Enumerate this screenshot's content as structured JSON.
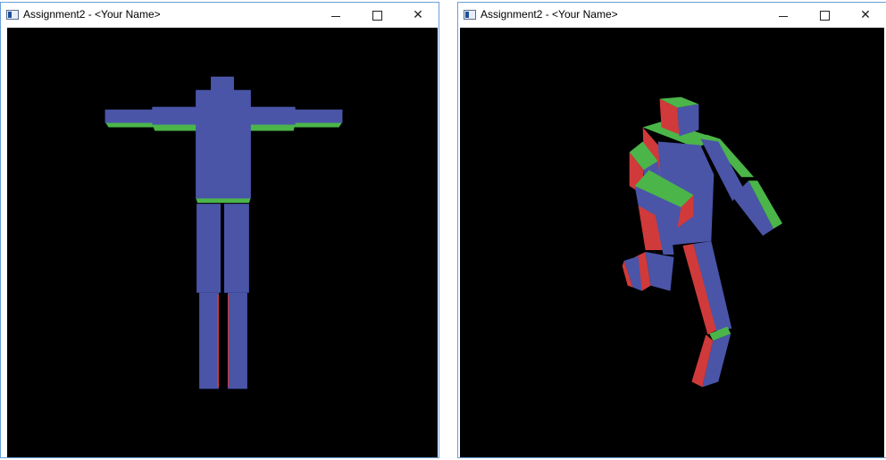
{
  "colors": {
    "front_face": "#4a55a8",
    "side_face": "#d03a3a",
    "top_face": "#4bb54a",
    "background": "#000000"
  },
  "windows": [
    {
      "title": "Assignment2 - <Your Name>",
      "pose": "T-pose, front view"
    },
    {
      "title": "Assignment2 - <Your Name>",
      "pose": "walking, rotated view"
    }
  ],
  "controls": {
    "minimize_icon": "minimize-icon",
    "maximize_icon": "maximize-icon",
    "close_icon": "close-icon"
  }
}
